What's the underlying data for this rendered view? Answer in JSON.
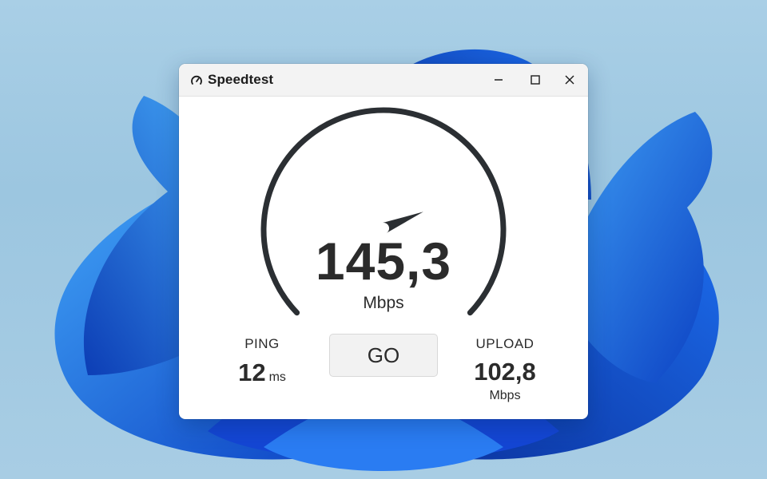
{
  "window": {
    "title": "Speedtest",
    "icon": "gauge-icon",
    "controls": {
      "minimize": "minimize-icon",
      "maximize": "maximize-icon",
      "close": "close-icon"
    }
  },
  "speedometer": {
    "value": "145,3",
    "unit": "Mbps",
    "needle_level": 0.75
  },
  "ping": {
    "label": "PING",
    "value": "12",
    "unit": "ms"
  },
  "go_button": {
    "label": "GO"
  },
  "upload": {
    "label": "UPLOAD",
    "value": "102,8",
    "unit": "Mbps"
  },
  "colors": {
    "gauge": "#2b2f33",
    "text": "#2b2b2b",
    "wallpaper_blue": "#1a5fe0",
    "wallpaper_bg": "#a9cfe6"
  }
}
